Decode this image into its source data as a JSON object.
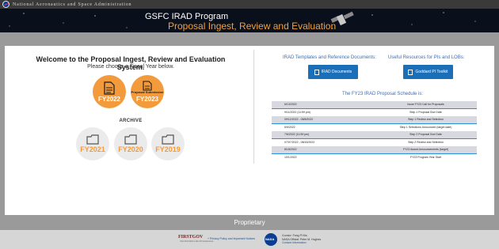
{
  "agency": {
    "name": "National Aeronautics and Space Administration"
  },
  "banner": {
    "title_line1": "GSFC IRAD Program",
    "title_line2": "Proposal Ingest, Review and Evaluation"
  },
  "left": {
    "welcome": "Welcome to the Proposal Ingest, Review and Evaluation System.",
    "choose": "Please choose a Fiscal Year below.",
    "current_years": [
      {
        "label": "FY2022",
        "sublabel": ""
      },
      {
        "label": "FY2023",
        "sublabel": "Proposal Submission"
      }
    ],
    "archive_title": "ARCHIVE",
    "archive_years": [
      "FY2021",
      "FY2020",
      "FY2019"
    ]
  },
  "right": {
    "templates_heading": "IRAD Templates and Reference Documents:",
    "resources_heading": "Useful Resources for PIs and LOBs:",
    "irad_documents_button": "IRAD Documents",
    "goddard_toolkit_button": "Goddard PI Toolkit",
    "schedule_title": "The FY23 IRAD Proposal Schedule is:",
    "schedule": [
      {
        "date": "6/13/2022",
        "event": "Issue FY23 Call for Proposals"
      },
      {
        "date": "9/11/2022 (11:59 pm)",
        "event": "Step 1 Proposal Due Date"
      },
      {
        "date": "09/12/2022 - 08/8/2022",
        "event": "Step 1 Review and Selection"
      },
      {
        "date": "6/9/2022",
        "event": "Step 1 Selections Announced (target date)"
      },
      {
        "date": "7/6/2022 (11:59 pm)",
        "event": "Step 2 Proposal Due Date"
      },
      {
        "date": "07/07/2022 - 08/16/2022",
        "event": "Step 2 Review and Selection"
      },
      {
        "date": "8/18/2022",
        "event": "FY23 Award Announcements (target)"
      },
      {
        "date": "10/1/2022",
        "event": "FY23 Program Year Start"
      }
    ]
  },
  "footer": {
    "proprietary": "Proprietary",
    "firstgov": "FIRSTGOV",
    "firstgov_sub": "Your First Click to the US Government",
    "policy": "+ Privacy Policy and Important Notices",
    "nasa": "NASA",
    "curator": "Curator: Fang Pi Ma",
    "official": "NASA Official: Peter M. Hughes",
    "contact": "Contact Information"
  },
  "colors": {
    "accent_orange": "#f39b3c",
    "link_blue": "#3b6fb6",
    "button_blue": "#1a6fb8",
    "schedule_rule": "#2b8fd6"
  },
  "icons": [
    "nasa-meatball-icon",
    "satellite-icon",
    "document-icon",
    "folder-icon"
  ]
}
